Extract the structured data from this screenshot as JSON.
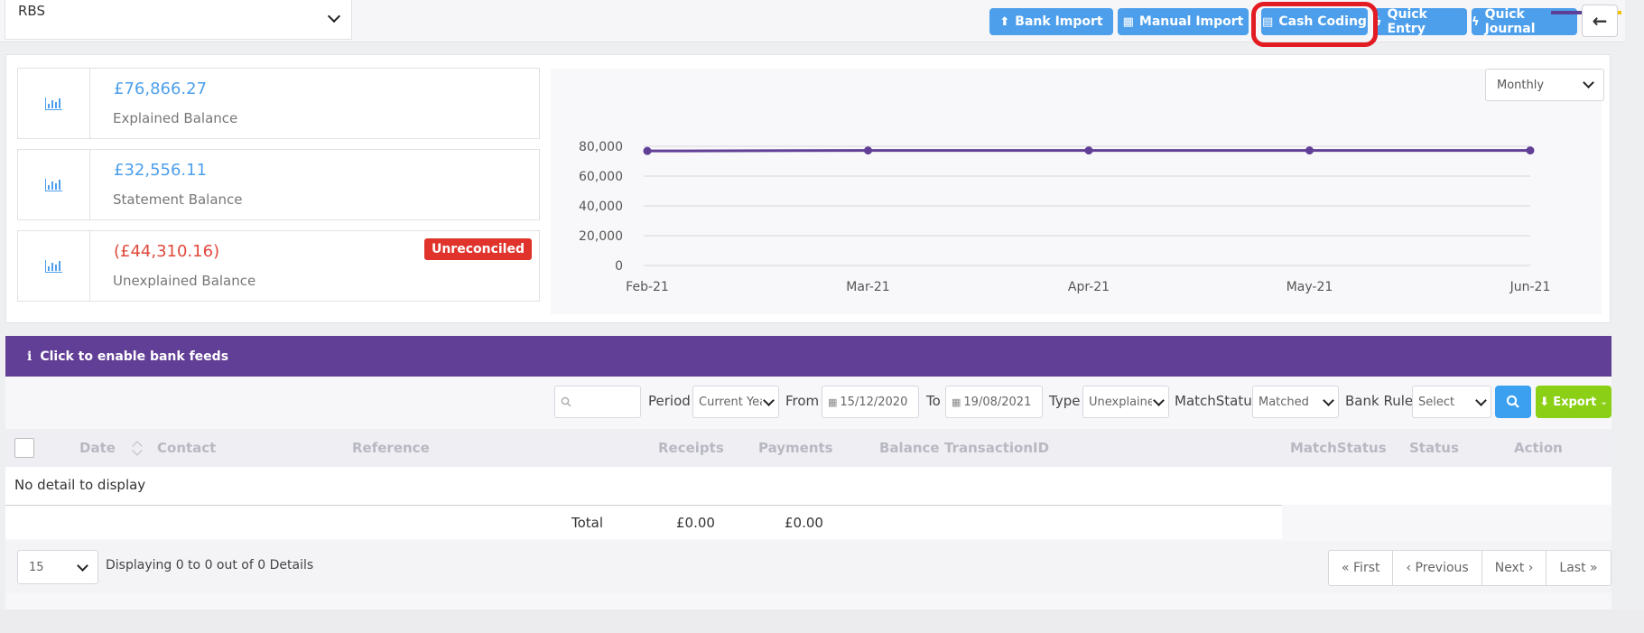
{
  "account": {
    "selected": "RBS"
  },
  "toolbar": {
    "bank_import": "Bank Import",
    "manual_import": "Manual Import",
    "cash_coding": "Cash Coding",
    "quick_entry": "Quick Entry",
    "quick_journal": "Quick Journal"
  },
  "balances": [
    {
      "amount": "£76,866.27",
      "label": "Explained Balance"
    },
    {
      "amount": "£32,556.11",
      "label": "Statement Balance"
    },
    {
      "amount": "(£44,310.16)",
      "label": "Unexplained Balance",
      "badge": "Unreconciled"
    }
  ],
  "chart_controls": {
    "period": "Monthly"
  },
  "chart_data": {
    "type": "line",
    "x": [
      "Feb-21",
      "Mar-21",
      "Apr-21",
      "May-21",
      "Jun-21"
    ],
    "series": [
      {
        "values": [
          76866,
          77200,
          77200,
          77200,
          77200
        ],
        "color": "#623f96"
      }
    ],
    "ylim": [
      0,
      80000
    ],
    "yticks": [
      "80,000",
      "60,000",
      "40,000",
      "20,000",
      "0"
    ],
    "ytick_values": [
      80000,
      60000,
      40000,
      20000,
      0
    ],
    "grid": true
  },
  "feeds_bar": {
    "icon": "i",
    "text": "Click to enable bank feeds"
  },
  "filters": {
    "period_label": "Period",
    "period_value": "Current Year",
    "from_label": "From",
    "from_value": "15/12/2020",
    "to_label": "To",
    "to_value": "19/08/2021",
    "type_label": "Type",
    "type_value": "Unexplained",
    "match_label": "MatchStatus",
    "match_value": "Matched",
    "rule_label": "Bank Rule",
    "rule_value": "Select",
    "export_label": "Export"
  },
  "table": {
    "headers": {
      "date": "Date",
      "contact": "Contact",
      "reference": "Reference",
      "receipts": "Receipts",
      "payments": "Payments",
      "balance": "Balance",
      "transaction_id": "TransactionID",
      "match_status": "MatchStatus",
      "status": "Status",
      "action": "Action"
    },
    "empty_text": "No detail to display",
    "total_label": "Total",
    "total_receipts": "£0.00",
    "total_payments": "£0.00"
  },
  "pagination": {
    "page_size": "15",
    "display_text": "Displaying 0 to 0 out of 0 Details",
    "first": "First",
    "previous": "Previous",
    "next": "Next",
    "last": "Last"
  },
  "colors": {
    "accent": "#4d9fec",
    "purple": "#623f96",
    "danger": "#e0332c",
    "export": "#8bd017",
    "highlight": "#e31b23"
  }
}
